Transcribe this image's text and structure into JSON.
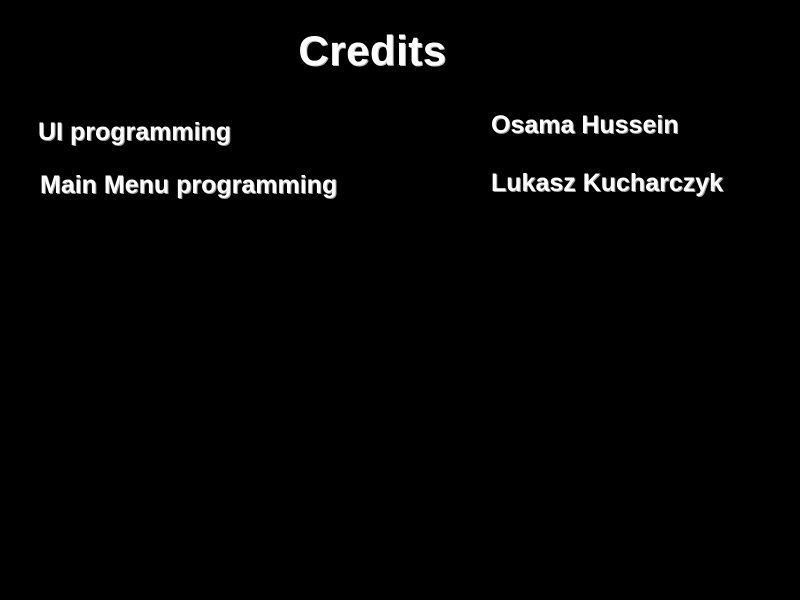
{
  "credits": {
    "title": "Credits",
    "entries": [
      {
        "role": "UI programming",
        "name": "Osama Hussein"
      },
      {
        "role": "Main Menu programming",
        "name": "Lukasz Kucharczyk"
      }
    ]
  },
  "colors": {
    "background": "#000000",
    "text": "#ffffff"
  }
}
